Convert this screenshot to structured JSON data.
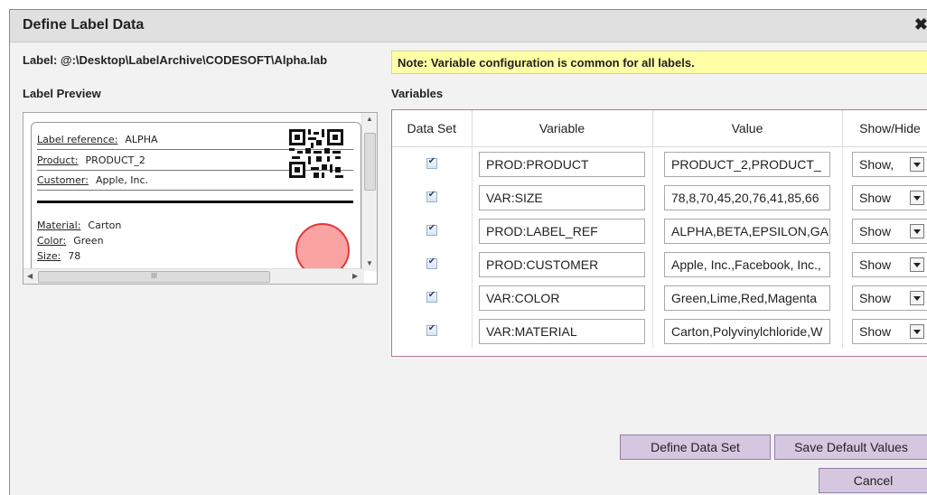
{
  "dialog": {
    "title": "Define Label Data",
    "label_path": "Label: @:\\Desktop\\LabelArchive\\CODESOFT\\Alpha.lab",
    "note": "Note: Variable configuration is common for all labels.",
    "preview_heading": "Label Preview",
    "variables_heading": "Variables"
  },
  "preview": {
    "label_reference_caption": "Label reference:",
    "label_reference_value": "ALPHA",
    "product_caption": "Product:",
    "product_value": "PRODUCT_2",
    "customer_caption": "Customer:",
    "customer_value": "Apple, Inc.",
    "material_caption": "Material:",
    "material_value": "Carton",
    "color_caption": "Color:",
    "color_value": "Green",
    "size_caption": "Size:",
    "size_value": "78",
    "scroll_grip": "III"
  },
  "table": {
    "headers": [
      "Data Set",
      "Variable",
      "Value",
      "Show/Hide"
    ],
    "rows": [
      {
        "data_set": true,
        "variable": "PROD:PRODUCT",
        "value": "PRODUCT_2,PRODUCT_",
        "show": "Show,"
      },
      {
        "data_set": true,
        "variable": "VAR:SIZE",
        "value": "78,8,70,45,20,76,41,85,66",
        "show": "Show"
      },
      {
        "data_set": true,
        "variable": "PROD:LABEL_REF",
        "value": "ALPHA,BETA,EPSILON,GA",
        "show": "Show"
      },
      {
        "data_set": true,
        "variable": "PROD:CUSTOMER",
        "value": "Apple, Inc.,Facebook, Inc.,",
        "show": "Show"
      },
      {
        "data_set": true,
        "variable": "VAR:COLOR",
        "value": "Green,Lime,Red,Magenta",
        "show": "Show"
      },
      {
        "data_set": true,
        "variable": "VAR:MATERIAL",
        "value": "Carton,Polyvinylchloride,W",
        "show": "Show"
      }
    ]
  },
  "buttons": {
    "define_data_set": "Define Data Set",
    "save_default_values": "Save Default Values",
    "cancel": "Cancel"
  },
  "colors": {
    "button_bg": "#d5c7e0",
    "note_bg": "#ffffa6",
    "table_border": "#b07a9c",
    "circle_fill": "#f9a3a3"
  }
}
